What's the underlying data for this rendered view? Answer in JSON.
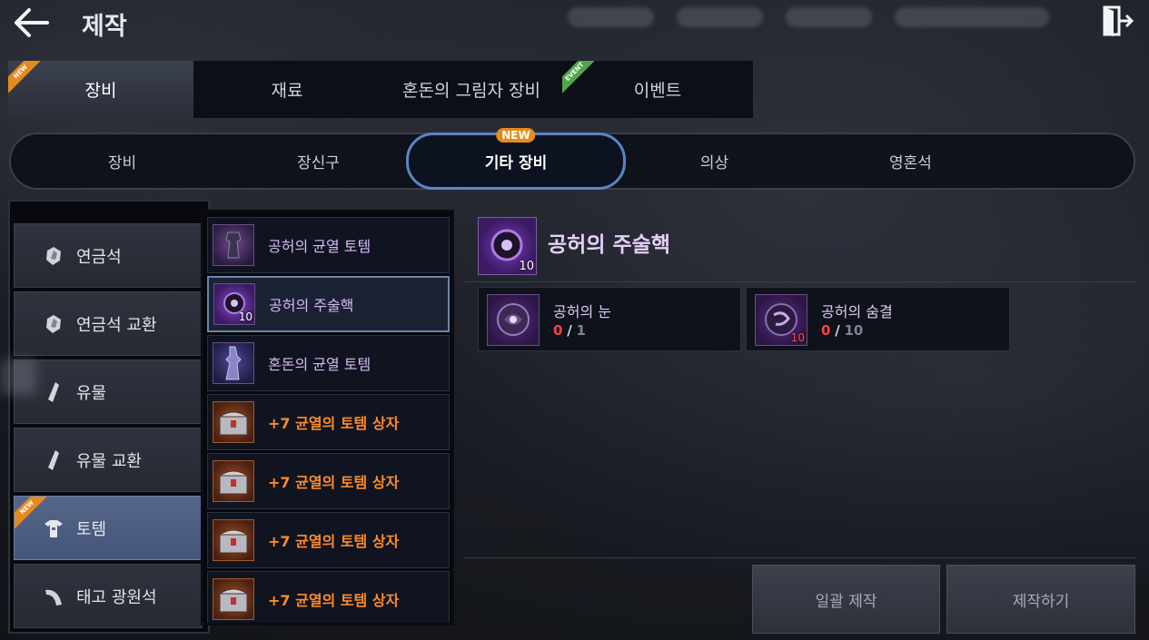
{
  "header": {
    "title": "제작"
  },
  "main_tabs": [
    {
      "label": "장비",
      "badge": "NEW"
    },
    {
      "label": "재료",
      "badge": ""
    },
    {
      "label": "혼돈의 그림자 장비",
      "badge": ""
    },
    {
      "label": "이벤트",
      "badge": "EVENT"
    }
  ],
  "sub_tabs": [
    {
      "label": "장비"
    },
    {
      "label": "장신구"
    },
    {
      "label": "기타 장비",
      "badge": "NEW"
    },
    {
      "label": "의상"
    },
    {
      "label": "영혼석"
    }
  ],
  "categories": [
    {
      "label": "연금석",
      "icon": "alchemy-stone-icon"
    },
    {
      "label": "연금석 교환",
      "icon": "alchemy-stone-icon"
    },
    {
      "label": "유물",
      "icon": "relic-icon"
    },
    {
      "label": "유물 교환",
      "icon": "relic-icon"
    },
    {
      "label": "토템",
      "icon": "totem-icon",
      "badge": "NEW"
    },
    {
      "label": "태고 광원석",
      "icon": "primal-ore-icon"
    }
  ],
  "items": [
    {
      "name": "공허의 균열 토템",
      "count": ""
    },
    {
      "name": "공허의 주술핵",
      "count": "10"
    },
    {
      "name": "혼돈의 균열 토템",
      "count": ""
    },
    {
      "name": "+7 균열의 토템 상자",
      "count": ""
    },
    {
      "name": "+7 균열의 토템 상자",
      "count": ""
    },
    {
      "name": "+7 균열의 토템 상자",
      "count": ""
    },
    {
      "name": "+7 균열의 토템 상자",
      "count": ""
    }
  ],
  "detail": {
    "title": "공허의 주술핵",
    "icon_count": "10",
    "materials": [
      {
        "name": "공허의 눈",
        "have": "0",
        "sep": "/",
        "need": "1",
        "icon_count": ""
      },
      {
        "name": "공허의 숨결",
        "have": "0",
        "sep": "/",
        "need": "10",
        "icon_count": "10"
      }
    ]
  },
  "actions": {
    "bulk_craft": "일괄 제작",
    "craft": "제작하기"
  },
  "colors": {
    "accent": "#5a86c4",
    "new_badge": "#e48c1c",
    "event_badge": "#4fa64a",
    "item_orange": "#ff8a2a",
    "item_purple": "#d7b9f4",
    "qty_red": "#ff4040"
  }
}
